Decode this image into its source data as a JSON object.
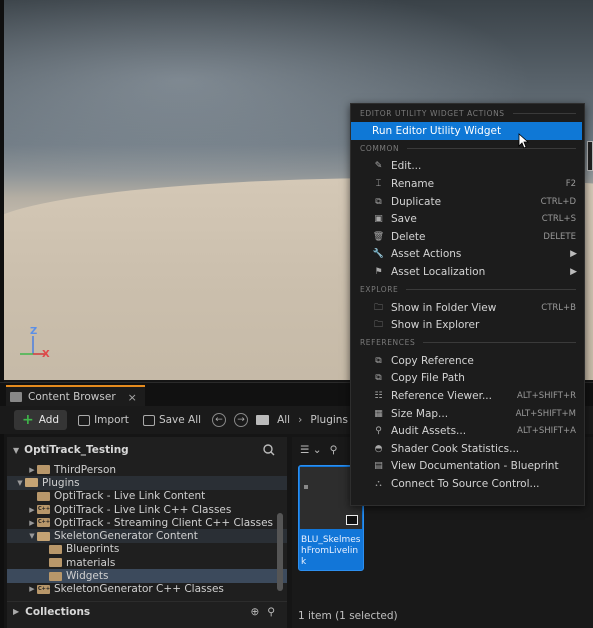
{
  "viewport": {
    "gizmo": {
      "z": "Z",
      "y": "Y",
      "x": "X"
    }
  },
  "content_browser": {
    "tab_label": "Content Browser",
    "tab_close": "×",
    "toolbar": {
      "add_label": "Add",
      "import_label": "Import",
      "save_all_label": "Save All",
      "breadcrumb": [
        "All",
        "Plugins"
      ]
    },
    "tree": {
      "root": "OptiTrack_Testing",
      "items": [
        {
          "label": "ThirdPerson",
          "indent": 1,
          "arrow": "▶",
          "icon": "folder",
          "state": ""
        },
        {
          "label": "Plugins",
          "indent": 0,
          "arrow": "▼",
          "icon": "folder-open",
          "state": "hl"
        },
        {
          "label": "OptiTrack - Live Link Content",
          "indent": 1,
          "arrow": "",
          "icon": "folder",
          "state": ""
        },
        {
          "label": "OptiTrack - Live Link C++ Classes",
          "indent": 1,
          "arrow": "▶",
          "icon": "folder-cpp",
          "state": ""
        },
        {
          "label": "OptiTrack - Streaming Client C++ Classes",
          "indent": 1,
          "arrow": "▶",
          "icon": "folder-cpp",
          "state": ""
        },
        {
          "label": "SkeletonGenerator Content",
          "indent": 1,
          "arrow": "▼",
          "icon": "folder-open",
          "state": "hl"
        },
        {
          "label": "Blueprints",
          "indent": 2,
          "arrow": "",
          "icon": "folder",
          "state": ""
        },
        {
          "label": "materials",
          "indent": 2,
          "arrow": "",
          "icon": "folder",
          "state": ""
        },
        {
          "label": "Widgets",
          "indent": 2,
          "arrow": "",
          "icon": "folder",
          "state": "sel"
        },
        {
          "label": "SkeletonGenerator C++ Classes",
          "indent": 1,
          "arrow": "▶",
          "icon": "folder-cpp",
          "state": ""
        }
      ],
      "collections_label": "Collections"
    },
    "asset": {
      "name": "BLU_SkelmeshFromLivelink",
      "status": "1 item (1 selected)"
    }
  },
  "context_menu": {
    "sections": [
      {
        "title": "EDITOR UTILITY WIDGET ACTIONS",
        "items": [
          {
            "label": "Run Editor Utility Widget",
            "shortcut": "",
            "icon": "",
            "active": true,
            "submenu": false
          }
        ]
      },
      {
        "title": "COMMON",
        "items": [
          {
            "label": "Edit...",
            "shortcut": "",
            "icon": "pencil-icon",
            "glyph": "✎"
          },
          {
            "label": "Rename",
            "shortcut": "F2",
            "icon": "rename-icon",
            "glyph": "⌶"
          },
          {
            "label": "Duplicate",
            "shortcut": "CTRL+D",
            "icon": "duplicate-icon",
            "glyph": "⧉"
          },
          {
            "label": "Save",
            "shortcut": "CTRL+S",
            "icon": "save-icon",
            "glyph": "▣"
          },
          {
            "label": "Delete",
            "shortcut": "DELETE",
            "icon": "trash-icon",
            "glyph": "🗑"
          },
          {
            "label": "Asset Actions",
            "shortcut": "",
            "icon": "wrench-icon",
            "glyph": "🔧",
            "submenu": true
          },
          {
            "label": "Asset Localization",
            "shortcut": "",
            "icon": "flag-icon",
            "glyph": "⚑",
            "submenu": true
          }
        ]
      },
      {
        "title": "EXPLORE",
        "items": [
          {
            "label": "Show in Folder View",
            "shortcut": "CTRL+B",
            "icon": "folder-search-icon",
            "glyph": "🗀"
          },
          {
            "label": "Show in Explorer",
            "shortcut": "",
            "icon": "folder-search-icon",
            "glyph": "🗀"
          }
        ]
      },
      {
        "title": "REFERENCES",
        "items": [
          {
            "label": "Copy Reference",
            "shortcut": "",
            "icon": "copy-icon",
            "glyph": "⧉"
          },
          {
            "label": "Copy File Path",
            "shortcut": "",
            "icon": "copy-icon",
            "glyph": "⧉"
          },
          {
            "label": "Reference Viewer...",
            "shortcut": "ALT+SHIFT+R",
            "icon": "reference-viewer-icon",
            "glyph": "☷"
          },
          {
            "label": "Size Map...",
            "shortcut": "ALT+SHIFT+M",
            "icon": "size-map-icon",
            "glyph": "▦"
          },
          {
            "label": "Audit Assets...",
            "shortcut": "ALT+SHIFT+A",
            "icon": "audit-icon",
            "glyph": "⚲"
          },
          {
            "label": "Shader Cook Statistics...",
            "shortcut": "",
            "icon": "shader-icon",
            "glyph": "◓"
          },
          {
            "label": "View Documentation - Blueprint",
            "shortcut": "",
            "icon": "book-icon",
            "glyph": "▤"
          },
          {
            "label": "Connect To Source Control...",
            "shortcut": "",
            "icon": "source-control-icon",
            "glyph": "⛬"
          }
        ]
      }
    ]
  }
}
